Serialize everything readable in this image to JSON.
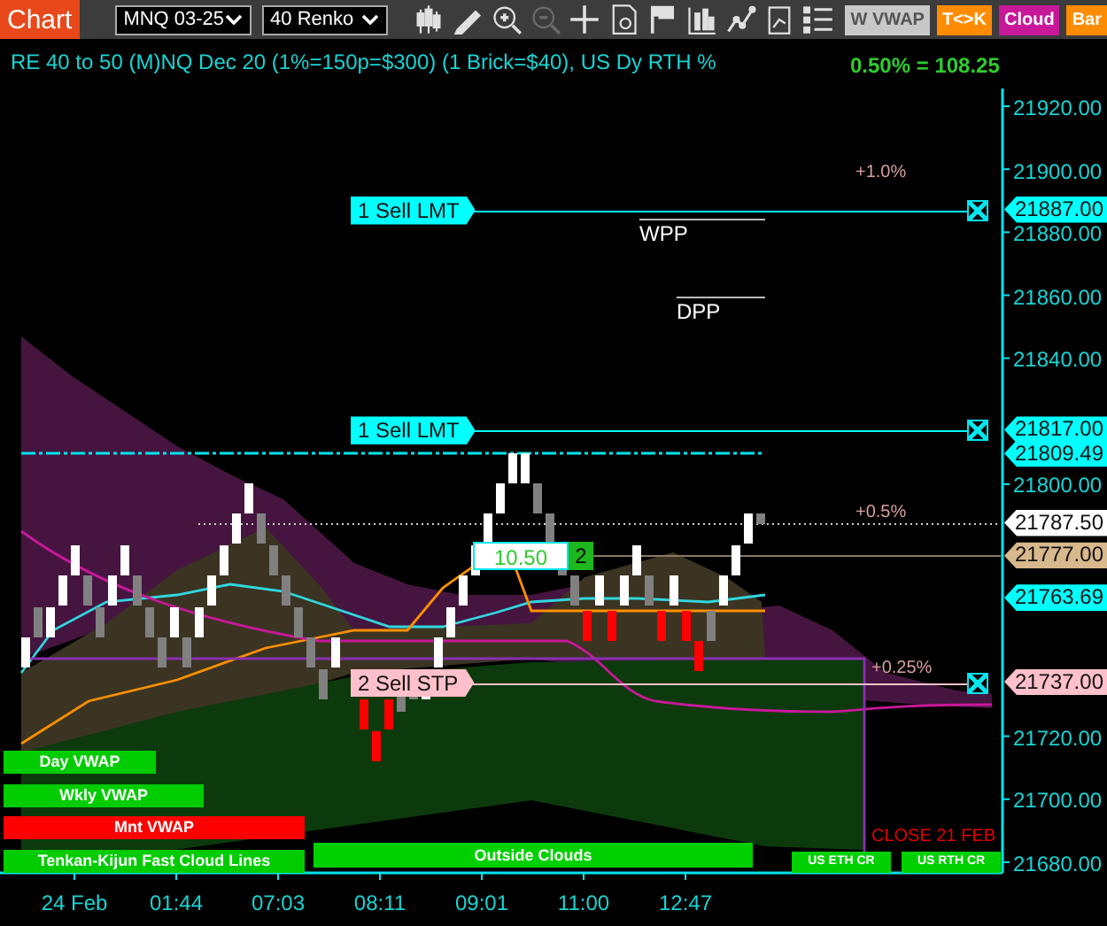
{
  "toolbar": {
    "app_button": "Chart",
    "instrument": "MNQ 03-25",
    "bar_type": "40 Renko",
    "tool_icons": [
      {
        "kind": "candles",
        "disabled": false
      },
      {
        "kind": "pencil",
        "disabled": false
      },
      {
        "kind": "zoom-in",
        "disabled": false
      },
      {
        "kind": "zoom-out",
        "disabled": true
      },
      {
        "kind": "crosshair",
        "disabled": false
      },
      {
        "kind": "document",
        "disabled": false
      },
      {
        "kind": "flag",
        "disabled": false
      },
      {
        "kind": "bars",
        "disabled": false
      },
      {
        "kind": "line",
        "disabled": false
      },
      {
        "kind": "clipboard",
        "disabled": false
      },
      {
        "kind": "list",
        "disabled": false
      }
    ],
    "toggles": [
      {
        "label": "W VWAP",
        "on": false,
        "color": "#c8c8c8"
      },
      {
        "label": "T<>K",
        "on": true,
        "color": "#ff8c00"
      },
      {
        "label": "Cloud",
        "on": true,
        "color": "#c8189a"
      },
      {
        "label": "Bar",
        "on": true,
        "color": "#ff8c00"
      }
    ]
  },
  "chart": {
    "title": "RE 40 to 50 (M)NQ Dec 20 (1%=150p=$300) (1 Brick=$40), US Dy RTH %",
    "percent_readout": "0.50% = 108.25",
    "price_axis": [
      "21920.00",
      "21900.00",
      "21880.00",
      "21860.00",
      "21840.00",
      "21800.00",
      "21720.00",
      "21700.00",
      "21680.00"
    ],
    "orders": [
      {
        "label": "1 Sell LMT",
        "kind": "limit",
        "price": "21887.00"
      },
      {
        "label": "1 Sell LMT",
        "kind": "limit",
        "price": "21817.00"
      },
      {
        "label": "2 Sell STP",
        "kind": "stop",
        "price": "21737.00"
      }
    ],
    "price_tags": [
      {
        "price": "21809.49",
        "color": "#00ffff"
      },
      {
        "price": "21787.50",
        "color": "#ffffff"
      },
      {
        "price": "21777.00",
        "color": "#d8b88c"
      },
      {
        "price": "21763.69",
        "color": "#00ffff"
      }
    ],
    "percent_levels": [
      "+1.0%",
      "+0.5%",
      "+0.25%"
    ],
    "pivots": [
      "WPP",
      "DPP"
    ],
    "position": {
      "pnl": "10.50",
      "quantity": "2"
    },
    "legend": [
      {
        "label": "Day VWAP",
        "color": "#00cc00"
      },
      {
        "label": "Wkly VWAP",
        "color": "#00cc00"
      },
      {
        "label": "Mnt VWAP",
        "color": "#ff0000"
      },
      {
        "label": "Tenkan-Kijun Fast Cloud Lines",
        "color": "#00cc00"
      }
    ],
    "session_bars": [
      "Outside Clouds",
      "US ETH CR",
      "US RTH CR"
    ],
    "session_label": "CLOSE 21 FEB",
    "time_axis": [
      "24 Feb",
      "01:44",
      "07:03",
      "08:11",
      "09:01",
      "11:00",
      "12:47"
    ]
  }
}
